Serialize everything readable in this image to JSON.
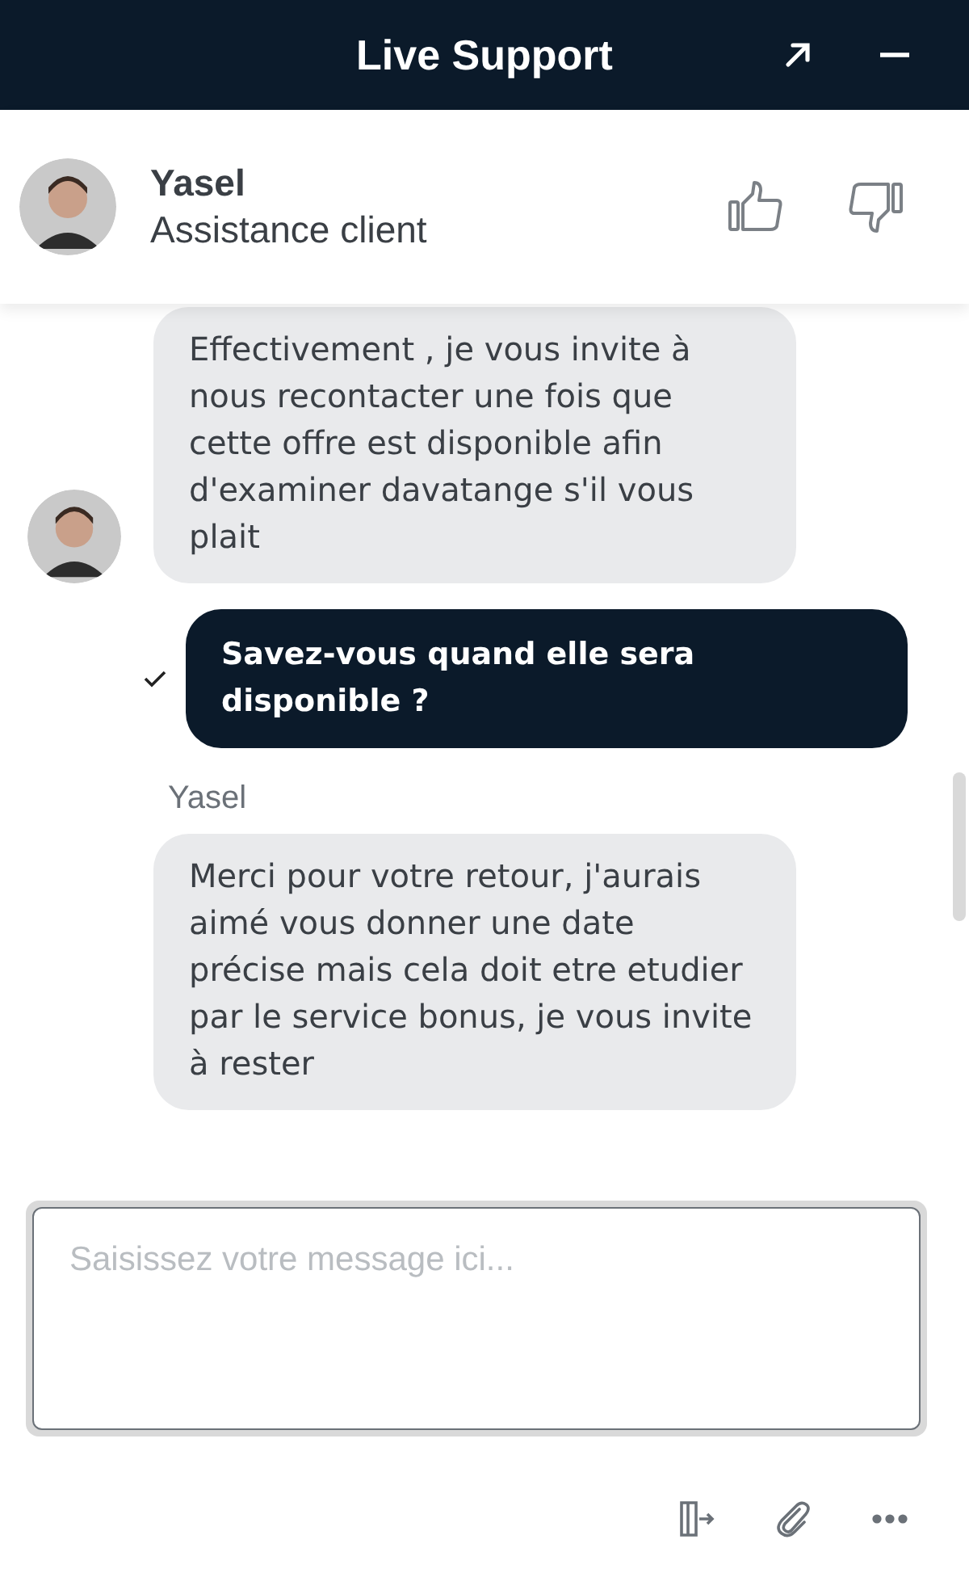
{
  "window": {
    "title": "Live Support"
  },
  "agent": {
    "name": "Yasel",
    "role": "Assistance client"
  },
  "messages": [
    {
      "kind": "agent",
      "text": "Effectivement , je vous invite à nous recontacter une fois que cette offre est disponible afin d'examiner davatange s'il vous plait",
      "avatar": true
    },
    {
      "kind": "user",
      "text": "Savez-vous quand elle sera disponible ?",
      "delivered": true
    },
    {
      "kind": "sender",
      "text": "Yasel"
    },
    {
      "kind": "agent",
      "text": "Merci pour votre retour, j'aurais aimé vous donner une date précise mais cela doit etre etudier par le service bonus, je vous invite à rester",
      "avatar": false
    }
  ],
  "composer": {
    "placeholder": "Saisissez votre message ici..."
  }
}
